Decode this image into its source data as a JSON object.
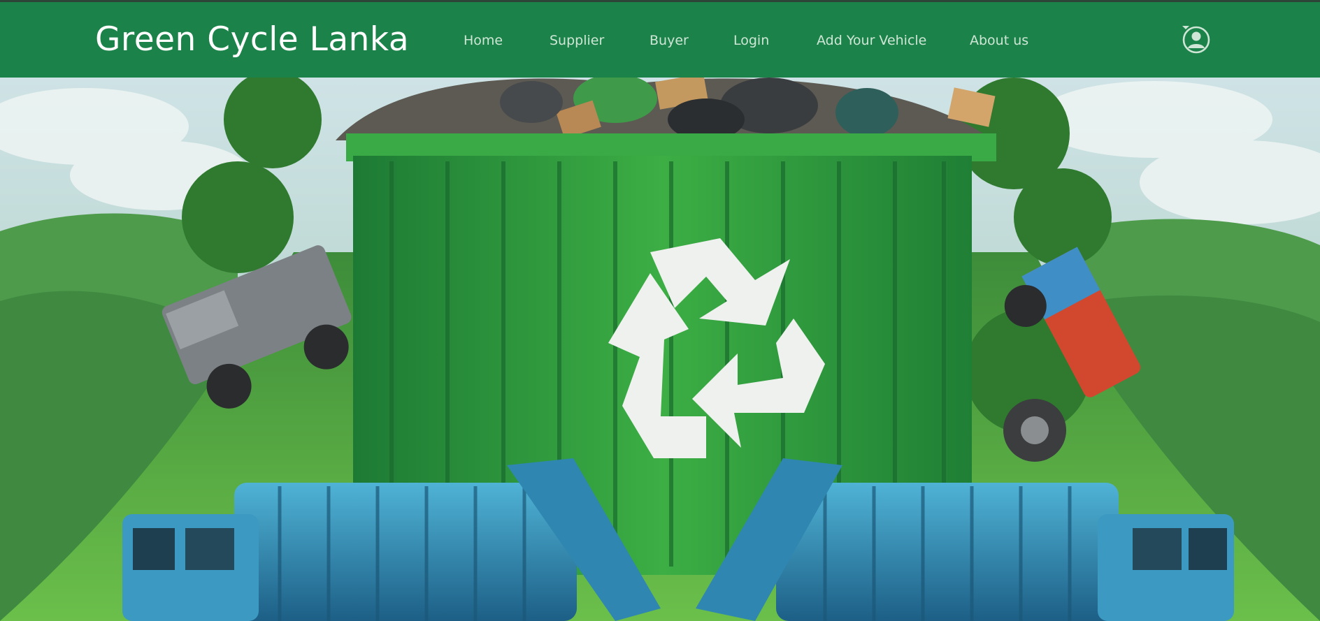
{
  "brand": {
    "name": "Green Cycle Lanka"
  },
  "nav": {
    "items": [
      {
        "label": "Home"
      },
      {
        "label": "Supplier"
      },
      {
        "label": "Buyer"
      },
      {
        "label": "Login"
      },
      {
        "label": "Add Your Vehicle"
      },
      {
        "label": "About us"
      }
    ]
  },
  "user_menu": {
    "icon": "user-circle-icon",
    "caret": "caret-down-icon"
  },
  "hero": {
    "image": "green-recycling-dumpster-with-garbage-trucks-illustration"
  },
  "colors": {
    "navbar": "#1b8249",
    "nav_text": "#cfe6d6",
    "brand_text": "#ffffff",
    "dumpster_green": "#2e9c3a",
    "truck_blue": "#2f86b0"
  }
}
